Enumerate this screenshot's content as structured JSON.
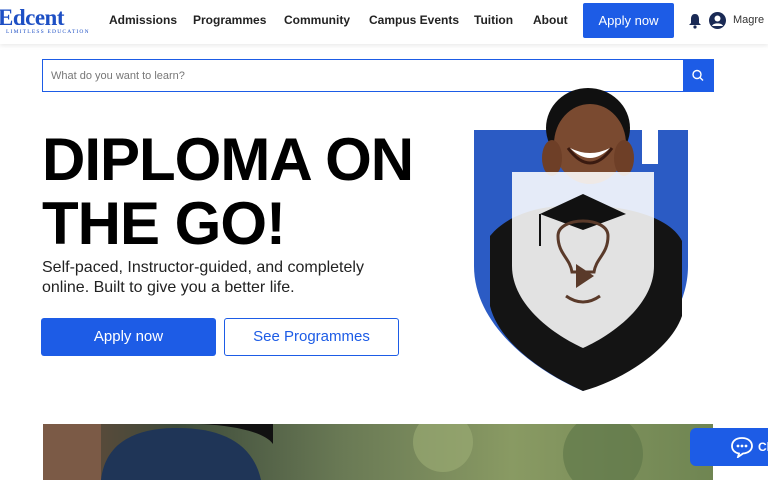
{
  "header": {
    "logo_text": "Edcent",
    "logo_tagline": "LIMITLESS EDUCATION",
    "nav": [
      "Admissions",
      "Programmes",
      "Community",
      "Campus Events",
      "Tuition",
      "About"
    ],
    "apply_label": "Apply now",
    "username": "Magre"
  },
  "search": {
    "placeholder": "What do you want to learn?"
  },
  "hero": {
    "title": "DIPLOMA ON THE GO!",
    "subtitle": "Self-paced, Instructor-guided, and completely online. Built to give you a better life.",
    "apply_label": "Apply now",
    "programmes_label": "See Programmes"
  },
  "chat": {
    "label": "Ch"
  },
  "colors": {
    "accent": "#1d5ce6",
    "brand": "#1d4fc4"
  },
  "icons": [
    "search-icon",
    "bell-icon",
    "user-icon",
    "chat-icon",
    "graduation-cap-icon",
    "play-icon"
  ]
}
